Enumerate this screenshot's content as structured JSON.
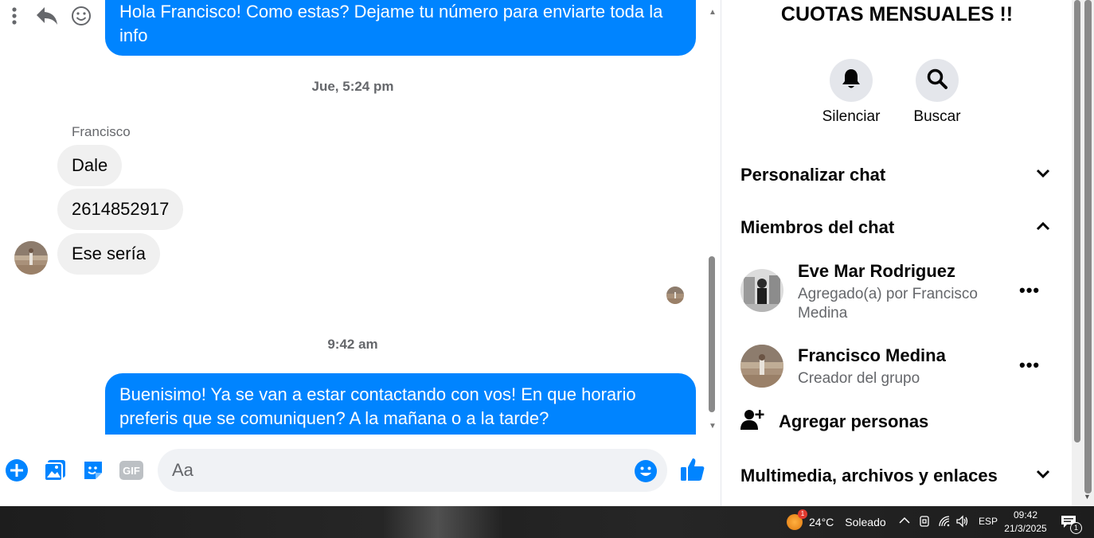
{
  "chat": {
    "top_message": "Hola Francisco! Como estas? Dejame tu número para enviarte toda la info",
    "timestamp_1": "Jue, 5:24 pm",
    "sender_name": "Francisco",
    "incoming": [
      "Dale",
      "2614852917",
      "Ese sería"
    ],
    "timestamp_2": "9:42 am",
    "bottom_message": "Buenisimo! Ya se van a estar contactando con vos! En que horario preferis que se comuniquen? A la mañana o a la tarde?"
  },
  "composer": {
    "placeholder": "Aa"
  },
  "info": {
    "title": "CUOTAS MENSUALES !!",
    "mute_label": "Silenciar",
    "search_label": "Buscar",
    "customize_label": "Personalizar chat",
    "members_label": "Miembros del chat",
    "members": [
      {
        "name": "Eve Mar Rodriguez",
        "sub": "Agregado(a) por Francisco Medina"
      },
      {
        "name": "Francisco Medina",
        "sub": "Creador del grupo"
      }
    ],
    "more_label": "•••",
    "add_people_label": "Agregar personas",
    "media_label": "Multimedia, archivos y enlaces"
  },
  "taskbar": {
    "notification_count": "1",
    "weather": "24°C",
    "weather_desc": "Soleado",
    "language": "ESP",
    "time": "09:42",
    "date": "21/3/2025",
    "action_center_count": "1"
  },
  "colors": {
    "accent": "#0084ff",
    "bubble_in": "#f0f0f0",
    "muted": "#65676b"
  }
}
